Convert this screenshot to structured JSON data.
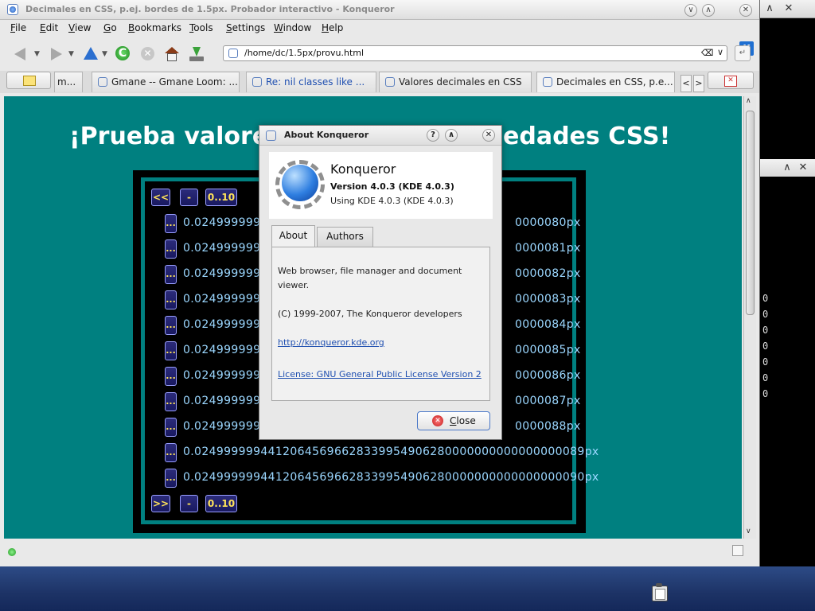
{
  "window": {
    "title": "Decimales en CSS, p.ej. bordes de 1.5px. Probador interactivo - Konqueror"
  },
  "titlebar_buttons": {
    "minimize": "∨",
    "maximize": "∧",
    "close": "✕"
  },
  "menu": [
    "File",
    "Edit",
    "View",
    "Go",
    "Bookmarks",
    "Tools",
    "Settings",
    "Window",
    "Help"
  ],
  "kde_logo": "K",
  "address": {
    "url": "/home/dc/1.5px/provu.html",
    "clear_glyph": "⌫",
    "dropdown_glyph": "∨"
  },
  "toolbar_icons": [
    "back-icon",
    "forward-icon",
    "up-icon",
    "reload-icon",
    "stop-icon",
    "home-icon",
    "download-icon"
  ],
  "tabs": [
    {
      "label": "m...",
      "link": false
    },
    {
      "label": "Gmane -- Gmane Loom: ...",
      "link": false
    },
    {
      "label": "Re: nil classes like ...",
      "link": true
    },
    {
      "label": "Valores decimales en CSS",
      "link": false
    },
    {
      "label": "Decimales en CSS, p.e...",
      "link": false
    }
  ],
  "tab_nav": {
    "prev": "<",
    "next": ">"
  },
  "page": {
    "heading_left": "¡Prueba valores",
    "heading_right": "edades CSS!",
    "top_buttons": [
      "<<",
      "-",
      "0..10"
    ],
    "bottom_buttons": [
      ">>",
      "-",
      "0..10"
    ],
    "ellipsis": "...",
    "rows": [
      {
        "head": "0.02499999944",
        "tail": "0000080px"
      },
      {
        "head": "0.02499999944",
        "tail": "0000081px"
      },
      {
        "head": "0.02499999944",
        "tail": "0000082px"
      },
      {
        "head": "0.02499999944",
        "tail": "0000083px"
      },
      {
        "head": "0.02499999944",
        "tail": "0000084px"
      },
      {
        "head": "0.02499999944",
        "tail": "0000085px"
      },
      {
        "head": "0.02499999944",
        "tail": "0000086px"
      },
      {
        "head": "0.02499999944",
        "tail": "0000087px"
      },
      {
        "head": "0.02499999944",
        "tail": "0000088px"
      },
      {
        "head": "0.02499999944120645696628339954906280000000000000000089px",
        "tail": ""
      },
      {
        "head": "0.02499999944120645696628339954906280000000000000000090px",
        "tail": ""
      }
    ]
  },
  "scrollbar": {
    "up": "∧",
    "down": "∨"
  },
  "dialog": {
    "title": "About Konqueror",
    "help_btn": "?",
    "shade_btn": "∧",
    "close_btn": "✕",
    "app_name": "Konqueror",
    "version": "Version 4.0.3 (KDE 4.0.3)",
    "using": "Using KDE 4.0.3 (KDE 4.0.3)",
    "tabs": [
      "About",
      "Authors"
    ],
    "description": "Web browser, file manager and document viewer.",
    "copyright": "(C) 1999-2007, The Konqueror developers",
    "homepage": "http://konqueror.kde.org",
    "license": "License: GNU General Public License Version 2",
    "close_label": "Close"
  },
  "bg_window": {
    "zeros": [
      "0",
      "0",
      "0",
      "0",
      "0",
      "0",
      "0"
    ],
    "close": "✕",
    "shade": "∧"
  }
}
